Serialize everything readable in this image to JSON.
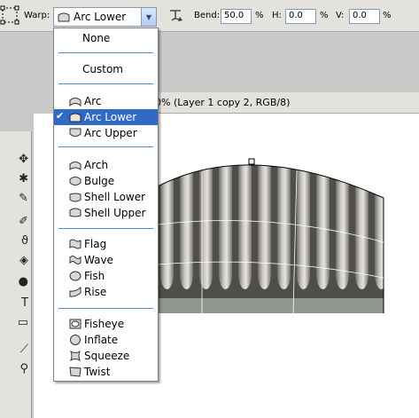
{
  "options_bar": {
    "warp_label": "Warp:",
    "warp_value": "Arc Lower",
    "bend_label": "Bend:",
    "bend_value": "50.0",
    "bend_unit": "%",
    "h_label": "H:",
    "h_value": "0.0",
    "h_unit": "%",
    "v_label": "V:",
    "v_value": "0.0",
    "v_unit": "%"
  },
  "document": {
    "title_fragment": "0% (Layer 1 copy 2, RGB/8)"
  },
  "warp_menu": {
    "items": [
      {
        "label": "None",
        "icon": "none",
        "selected": false
      },
      {
        "label": "Custom",
        "icon": "none",
        "selected": false
      },
      {
        "label": "Arc",
        "icon": "arc-icon",
        "selected": false
      },
      {
        "label": "Arc Lower",
        "icon": "arc-lower-icon",
        "selected": true
      },
      {
        "label": "Arc Upper",
        "icon": "arc-upper-icon",
        "selected": false
      },
      {
        "label": "Arch",
        "icon": "arch-icon",
        "selected": false
      },
      {
        "label": "Bulge",
        "icon": "bulge-icon",
        "selected": false
      },
      {
        "label": "Shell Lower",
        "icon": "shell-lower-icon",
        "selected": false
      },
      {
        "label": "Shell Upper",
        "icon": "shell-upper-icon",
        "selected": false
      },
      {
        "label": "Flag",
        "icon": "flag-icon",
        "selected": false
      },
      {
        "label": "Wave",
        "icon": "wave-icon",
        "selected": false
      },
      {
        "label": "Fish",
        "icon": "fish-icon",
        "selected": false
      },
      {
        "label": "Rise",
        "icon": "rise-icon",
        "selected": false
      },
      {
        "label": "Fisheye",
        "icon": "fisheye-icon",
        "selected": false
      },
      {
        "label": "Inflate",
        "icon": "inflate-icon",
        "selected": false
      },
      {
        "label": "Squeeze",
        "icon": "squeeze-icon",
        "selected": false
      },
      {
        "label": "Twist",
        "icon": "twist-icon",
        "selected": false
      }
    ],
    "check_mark": "✔"
  },
  "colors": {
    "menu_highlight": "#316ac5",
    "separator": "#5a8ad0",
    "chrome": "#e4e2dc"
  }
}
